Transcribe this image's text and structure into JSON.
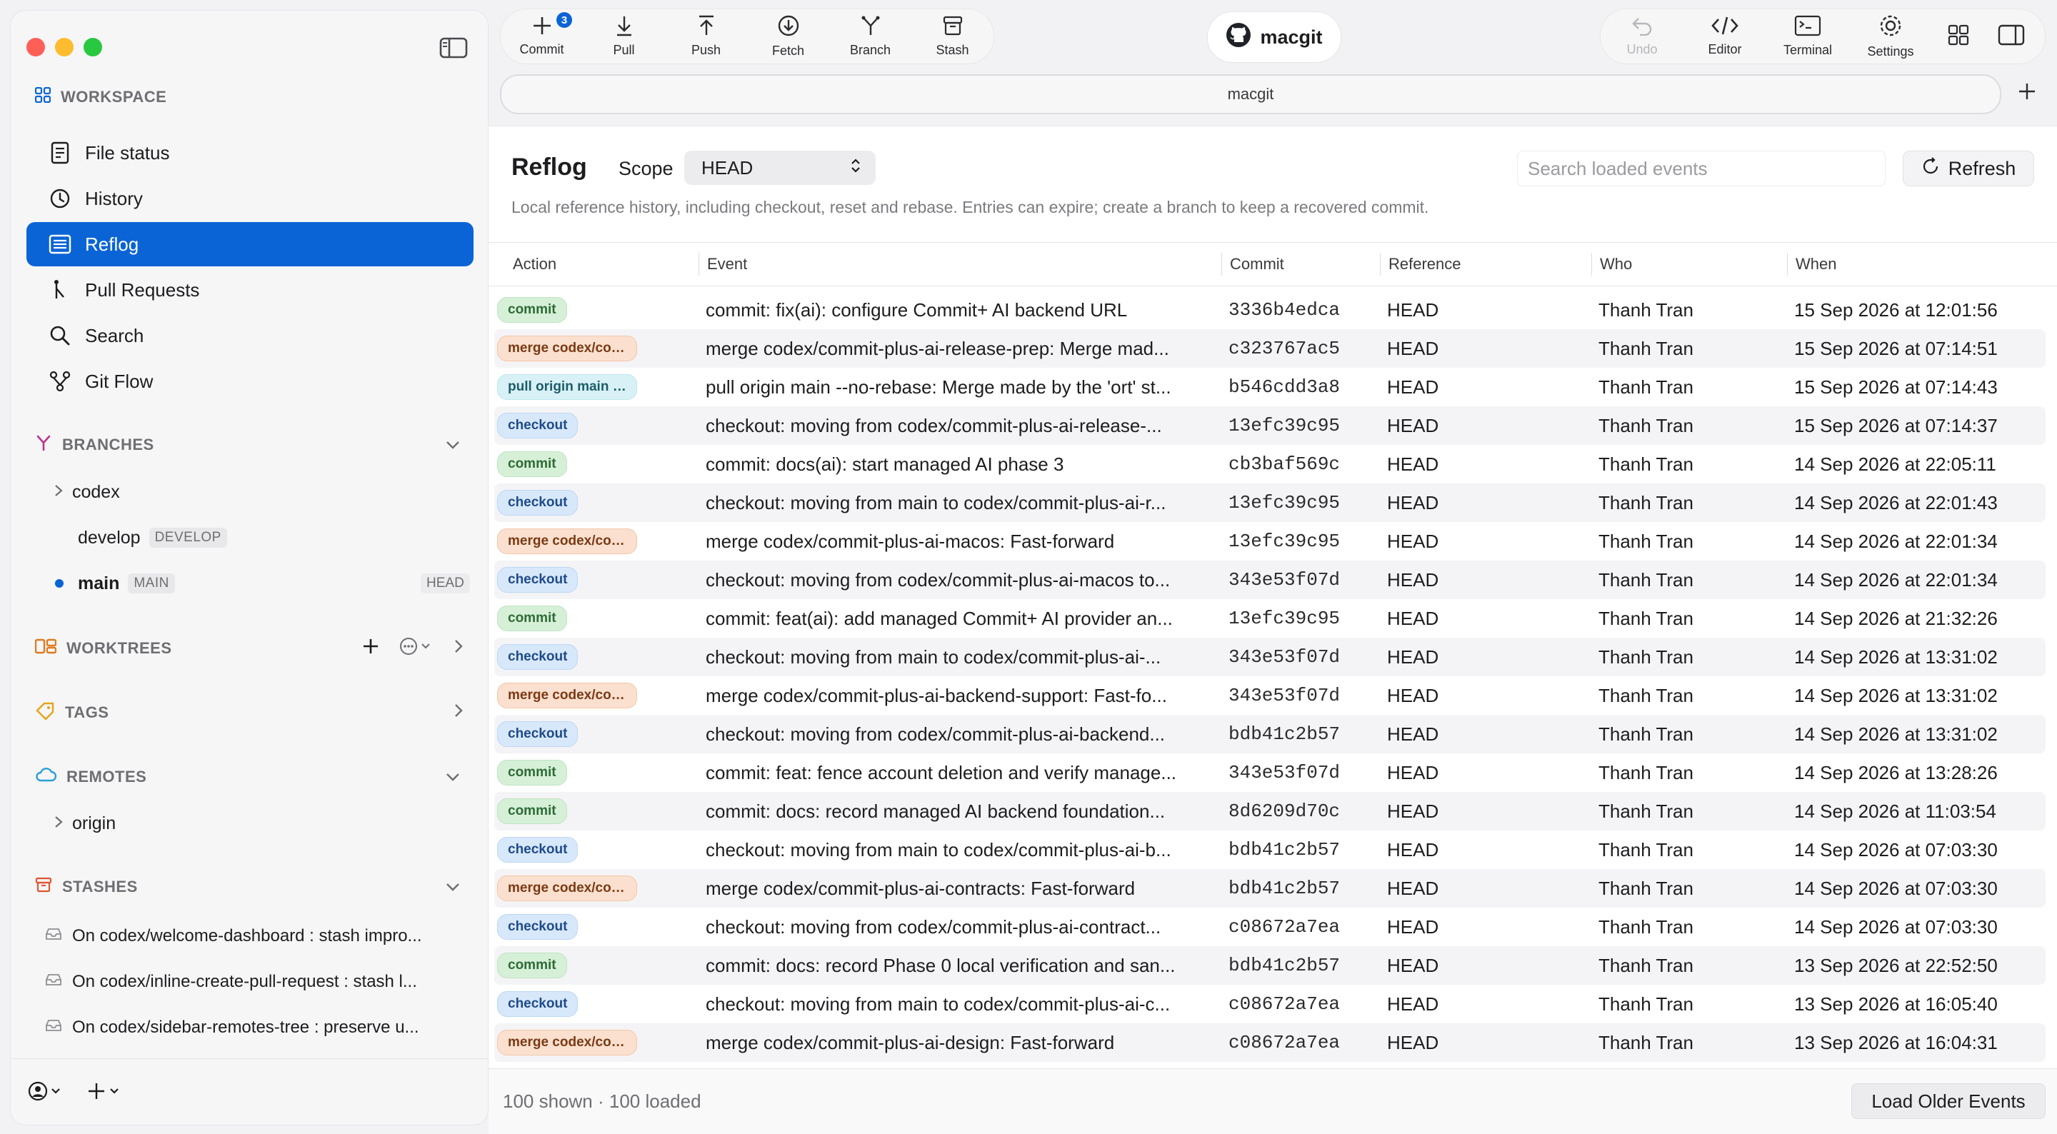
{
  "app": {
    "repo_name": "macgit",
    "tab_label": "macgit"
  },
  "toolbar": {
    "left": [
      {
        "label": "Commit",
        "icon": "plus-icon",
        "badge": "3"
      },
      {
        "label": "Pull",
        "icon": "arrow-down-icon"
      },
      {
        "label": "Push",
        "icon": "arrow-up-icon"
      },
      {
        "label": "Fetch",
        "icon": "circle-arrow-down-icon"
      },
      {
        "label": "Branch",
        "icon": "branch-icon"
      },
      {
        "label": "Stash",
        "icon": "archive-box-icon"
      }
    ],
    "right": [
      {
        "label": "Undo",
        "icon": "undo-icon",
        "disabled": true
      },
      {
        "label": "Editor",
        "icon": "code-icon"
      },
      {
        "label": "Terminal",
        "icon": "terminal-icon"
      },
      {
        "label": "Settings",
        "icon": "gear-icon"
      }
    ]
  },
  "sidebar": {
    "workspace_title": "WORKSPACE",
    "nav": [
      {
        "label": "File status",
        "icon": "document-icon"
      },
      {
        "label": "History",
        "icon": "clock-icon"
      },
      {
        "label": "Reflog",
        "icon": "list-icon",
        "active": true
      },
      {
        "label": "Pull Requests",
        "icon": "pull-request-icon"
      },
      {
        "label": "Search",
        "icon": "search-icon"
      },
      {
        "label": "Git Flow",
        "icon": "flow-icon"
      }
    ],
    "branches_title": "BRANCHES",
    "branches": {
      "codex": "codex",
      "develop": "develop",
      "develop_tag": "DEVELOP",
      "main": "main",
      "main_tag": "MAIN",
      "head_tag": "HEAD"
    },
    "worktrees_title": "WORKTREES",
    "tags_title": "TAGS",
    "remotes_title": "REMOTES",
    "remotes": [
      "origin"
    ],
    "stashes_title": "STASHES",
    "stashes": [
      "On codex/welcome-dashboard : stash impro...",
      "On codex/inline-create-pull-request : stash l...",
      "On codex/sidebar-remotes-tree : preserve u..."
    ]
  },
  "reflog": {
    "title": "Reflog",
    "scope_label": "Scope",
    "scope_value": "HEAD",
    "search_placeholder": "Search loaded events",
    "refresh_label": "Refresh",
    "subtitle": "Local reference history, including checkout, reset and rebase. Entries can expire; create a branch to keep a recovered commit.",
    "columns": [
      "Action",
      "Event",
      "Commit",
      "Reference",
      "Who",
      "When"
    ],
    "rows": [
      {
        "action": "commit",
        "kind": "commit",
        "event": "commit: fix(ai): configure Commit+ AI backend URL",
        "commit": "3336b4edca",
        "reference": "HEAD",
        "who": "Thanh Tran",
        "when": "15 Sep 2026 at 12:01:56"
      },
      {
        "action": "merge codex/com...",
        "kind": "merge",
        "event": "merge codex/commit-plus-ai-release-prep: Merge mad...",
        "commit": "c323767ac5",
        "reference": "HEAD",
        "who": "Thanh Tran",
        "when": "15 Sep 2026 at 07:14:51"
      },
      {
        "action": "pull origin main --...",
        "kind": "pull",
        "event": "pull origin main --no-rebase: Merge made by the 'ort' st...",
        "commit": "b546cdd3a8",
        "reference": "HEAD",
        "who": "Thanh Tran",
        "when": "15 Sep 2026 at 07:14:43"
      },
      {
        "action": "checkout",
        "kind": "checkout",
        "event": "checkout: moving from codex/commit-plus-ai-release-...",
        "commit": "13efc39c95",
        "reference": "HEAD",
        "who": "Thanh Tran",
        "when": "15 Sep 2026 at 07:14:37"
      },
      {
        "action": "commit",
        "kind": "commit",
        "event": "commit: docs(ai): start managed AI phase 3",
        "commit": "cb3baf569c",
        "reference": "HEAD",
        "who": "Thanh Tran",
        "when": "14 Sep 2026 at 22:05:11"
      },
      {
        "action": "checkout",
        "kind": "checkout",
        "event": "checkout: moving from main to codex/commit-plus-ai-r...",
        "commit": "13efc39c95",
        "reference": "HEAD",
        "who": "Thanh Tran",
        "when": "14 Sep 2026 at 22:01:43"
      },
      {
        "action": "merge codex/com...",
        "kind": "merge",
        "event": "merge codex/commit-plus-ai-macos: Fast-forward",
        "commit": "13efc39c95",
        "reference": "HEAD",
        "who": "Thanh Tran",
        "when": "14 Sep 2026 at 22:01:34"
      },
      {
        "action": "checkout",
        "kind": "checkout",
        "event": "checkout: moving from codex/commit-plus-ai-macos to...",
        "commit": "343e53f07d",
        "reference": "HEAD",
        "who": "Thanh Tran",
        "when": "14 Sep 2026 at 22:01:34"
      },
      {
        "action": "commit",
        "kind": "commit",
        "event": "commit: feat(ai): add managed Commit+ AI provider an...",
        "commit": "13efc39c95",
        "reference": "HEAD",
        "who": "Thanh Tran",
        "when": "14 Sep 2026 at 21:32:26"
      },
      {
        "action": "checkout",
        "kind": "checkout",
        "event": "checkout: moving from main to codex/commit-plus-ai-...",
        "commit": "343e53f07d",
        "reference": "HEAD",
        "who": "Thanh Tran",
        "when": "14 Sep 2026 at 13:31:02"
      },
      {
        "action": "merge codex/com...",
        "kind": "merge",
        "event": "merge codex/commit-plus-ai-backend-support: Fast-fo...",
        "commit": "343e53f07d",
        "reference": "HEAD",
        "who": "Thanh Tran",
        "when": "14 Sep 2026 at 13:31:02"
      },
      {
        "action": "checkout",
        "kind": "checkout",
        "event": "checkout: moving from codex/commit-plus-ai-backend...",
        "commit": "bdb41c2b57",
        "reference": "HEAD",
        "who": "Thanh Tran",
        "when": "14 Sep 2026 at 13:31:02"
      },
      {
        "action": "commit",
        "kind": "commit",
        "event": "commit: feat: fence account deletion and verify manage...",
        "commit": "343e53f07d",
        "reference": "HEAD",
        "who": "Thanh Tran",
        "when": "14 Sep 2026 at 13:28:26"
      },
      {
        "action": "commit",
        "kind": "commit",
        "event": "commit: docs: record managed AI backend foundation...",
        "commit": "8d6209d70c",
        "reference": "HEAD",
        "who": "Thanh Tran",
        "when": "14 Sep 2026 at 11:03:54"
      },
      {
        "action": "checkout",
        "kind": "checkout",
        "event": "checkout: moving from main to codex/commit-plus-ai-b...",
        "commit": "bdb41c2b57",
        "reference": "HEAD",
        "who": "Thanh Tran",
        "when": "14 Sep 2026 at 07:03:30"
      },
      {
        "action": "merge codex/com...",
        "kind": "merge",
        "event": "merge codex/commit-plus-ai-contracts: Fast-forward",
        "commit": "bdb41c2b57",
        "reference": "HEAD",
        "who": "Thanh Tran",
        "when": "14 Sep 2026 at 07:03:30"
      },
      {
        "action": "checkout",
        "kind": "checkout",
        "event": "checkout: moving from codex/commit-plus-ai-contract...",
        "commit": "c08672a7ea",
        "reference": "HEAD",
        "who": "Thanh Tran",
        "when": "14 Sep 2026 at 07:03:30"
      },
      {
        "action": "commit",
        "kind": "commit",
        "event": "commit: docs: record Phase 0 local verification and san...",
        "commit": "bdb41c2b57",
        "reference": "HEAD",
        "who": "Thanh Tran",
        "when": "13 Sep 2026 at 22:52:50"
      },
      {
        "action": "checkout",
        "kind": "checkout",
        "event": "checkout: moving from main to codex/commit-plus-ai-c...",
        "commit": "c08672a7ea",
        "reference": "HEAD",
        "who": "Thanh Tran",
        "when": "13 Sep 2026 at 16:05:40"
      },
      {
        "action": "merge codex/com...",
        "kind": "merge",
        "event": "merge codex/commit-plus-ai-design: Fast-forward",
        "commit": "c08672a7ea",
        "reference": "HEAD",
        "who": "Thanh Tran",
        "when": "13 Sep 2026 at 16:04:31"
      }
    ],
    "status": "100 shown · 100 loaded",
    "load_older_label": "Load Older Events"
  },
  "colors": {
    "accent": "#0a64d6",
    "branches_icon": "#c0338c",
    "worktrees_icon": "#e07a1f",
    "tags_icon": "#e8a21a",
    "remotes_icon": "#2a9fd6",
    "stashes_icon": "#e0552f"
  }
}
